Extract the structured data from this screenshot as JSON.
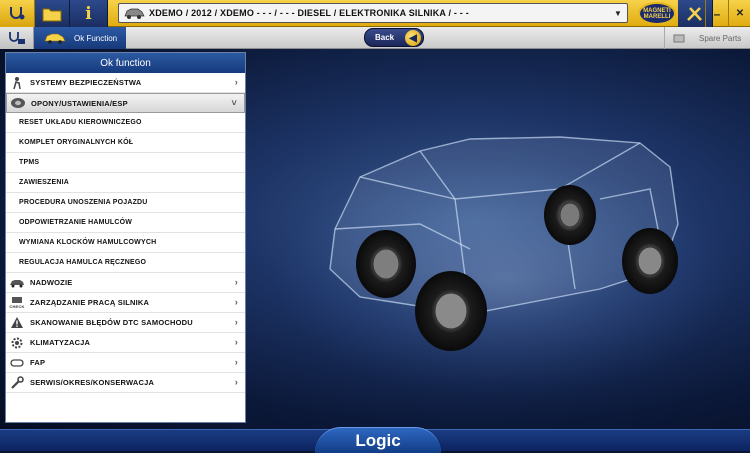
{
  "toolbar": {
    "home_icon": "stethoscope-icon",
    "folder_icon": "folder-icon",
    "info_label": "i",
    "vehicle_path": "XDEMO / 2012 / XDEMO - - - / - - - DIESEL / ELEKTRONIKA SILNIKA / - - -",
    "brand_text": "MAGNETI MARELLI",
    "minimize_label": "–",
    "close_label": "✕"
  },
  "secondary": {
    "tab_label": "Ok Function",
    "back_label": "Back",
    "spare_parts_label": "Spare Parts"
  },
  "panel": {
    "title": "Ok function",
    "items": [
      {
        "label": "SYSTEMY BEZPIECZEŃSTWA",
        "icon": "airbag-person-icon"
      },
      {
        "label": "OPONY/USTAWIENIA/ESP",
        "icon": "tire-icon"
      },
      {
        "label": "RESET UKŁADU KIEROWNICZEGO"
      },
      {
        "label": "KOMPLET ORYGINALNYCH KÓŁ"
      },
      {
        "label": "TPMS"
      },
      {
        "label": "ZAWIESZENIA"
      },
      {
        "label": "PROCEDURA UNOSZENIA POJAZDU"
      },
      {
        "label": "ODPOWIETRZANIE HAMULCÓW"
      },
      {
        "label": "WYMIANA KLOCKÓW HAMULCOWYCH"
      },
      {
        "label": "REGULACJA HAMULCA RĘCZNEGO"
      },
      {
        "label": "NADWOZIE",
        "icon": "car-body-icon"
      },
      {
        "label": "ZARZĄDZANIE PRACĄ SILNIKA",
        "icon": "check-engine-icon",
        "icon_text": "CHECK"
      },
      {
        "label": "SKANOWANIE BŁĘDÓW DTC SAMOCHODU",
        "icon": "warning-icon"
      },
      {
        "label": "KLIMATYZACJA",
        "icon": "ac-gear-icon"
      },
      {
        "label": "FAP",
        "icon": "particulate-filter-icon"
      },
      {
        "label": "SERWIS/OKRES/KONSERWACJA",
        "icon": "wrench-icon"
      }
    ]
  },
  "footer": {
    "logo_text": "Logic"
  },
  "colors": {
    "accent_yellow": "#f6d24a",
    "navy": "#1b2b6b",
    "panel_blue": "#2b5aa2"
  }
}
